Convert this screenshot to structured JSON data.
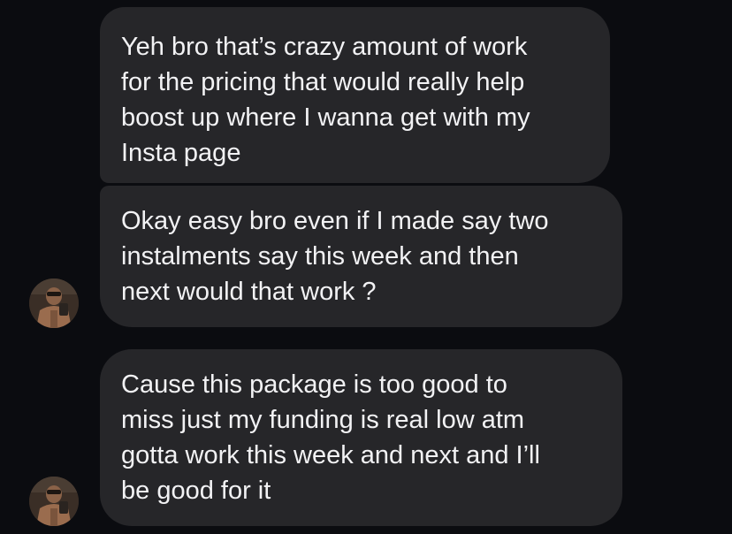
{
  "messages": [
    {
      "text": "Yeh bro that’s crazy amount of work\nfor the pricing that would really help\nboost up where I wanna get with my\nInsta page"
    },
    {
      "text": "Okay easy bro even if I made say two\ninstalments say this week and then\nnext would that work ?"
    },
    {
      "text": "Cause this package is too good to\nmiss just my funding is real low atm\ngotta work this week and next and I’ll\nbe good for it"
    }
  ],
  "avatar": {
    "icon": "person-avatar"
  }
}
